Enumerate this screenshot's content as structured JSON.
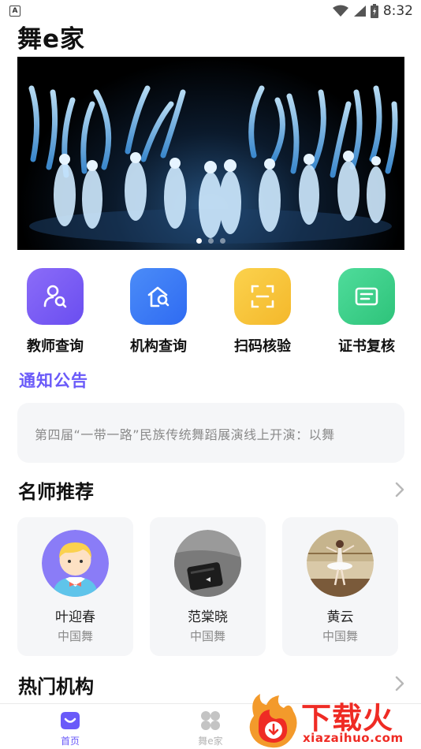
{
  "status_bar": {
    "time": "8:32",
    "notification_badge": "A"
  },
  "app": {
    "title": "舞e家"
  },
  "banner": {
    "slides": 3,
    "active_slide": 0
  },
  "quick_actions": [
    {
      "label": "教师查询",
      "icon": "teacher-search-icon",
      "color": "#7a5cf5"
    },
    {
      "label": "机构查询",
      "icon": "institution-search-icon",
      "color": "#3b7cf6"
    },
    {
      "label": "扫码核验",
      "icon": "scan-code-icon",
      "color": "#f7c53a"
    },
    {
      "label": "证书复核",
      "icon": "certificate-icon",
      "color": "#38d189"
    }
  ],
  "notice": {
    "title": "通知公告",
    "text": "第四届“一带一路”民族传统舞蹈展演线上开演：以舞"
  },
  "teachers_section": {
    "title": "名师推荐"
  },
  "teachers": [
    {
      "name": "叶迎春",
      "style": "中国舞"
    },
    {
      "name": "范棠晓",
      "style": "中国舞"
    },
    {
      "name": "黄云",
      "style": "中国舞"
    }
  ],
  "institutions_section": {
    "title": "热门机构"
  },
  "tabs": [
    {
      "label": "首页",
      "active": true
    },
    {
      "label": "舞e家",
      "active": false
    }
  ],
  "watermark": {
    "text": "下载火",
    "url": "xiazaihuo.com"
  },
  "colors": {
    "accent": "#6a5af9",
    "tab_active": "#6a5af9",
    "tab_inactive": "#b5b5b5",
    "card_bg": "#f5f6f8"
  }
}
